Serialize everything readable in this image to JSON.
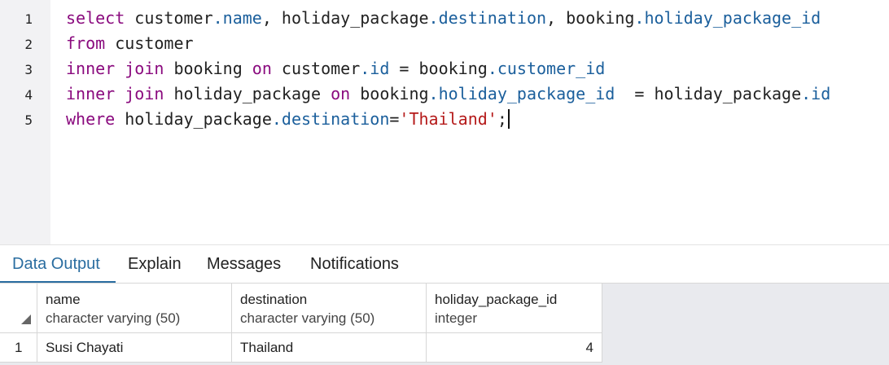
{
  "editor": {
    "line_numbers": [
      "1",
      "2",
      "3",
      "4",
      "5"
    ],
    "lines": [
      [
        {
          "t": "select",
          "k": "kw"
        },
        {
          "t": " customer",
          "k": ""
        },
        {
          "t": ".name",
          "k": "prop"
        },
        {
          "t": ", holiday_package",
          "k": ""
        },
        {
          "t": ".destination",
          "k": "prop"
        },
        {
          "t": ", booking",
          "k": ""
        },
        {
          "t": ".holiday_package_id",
          "k": "prop"
        }
      ],
      [
        {
          "t": "from",
          "k": "kw"
        },
        {
          "t": " customer",
          "k": ""
        }
      ],
      [
        {
          "t": "inner join",
          "k": "kw"
        },
        {
          "t": " booking ",
          "k": ""
        },
        {
          "t": "on",
          "k": "kw"
        },
        {
          "t": " customer",
          "k": ""
        },
        {
          "t": ".id",
          "k": "prop"
        },
        {
          "t": " = booking",
          "k": ""
        },
        {
          "t": ".customer_id",
          "k": "prop"
        }
      ],
      [
        {
          "t": "inner join",
          "k": "kw"
        },
        {
          "t": " holiday_package ",
          "k": ""
        },
        {
          "t": "on",
          "k": "kw"
        },
        {
          "t": " booking",
          "k": ""
        },
        {
          "t": ".holiday_package_id",
          "k": "prop"
        },
        {
          "t": "  = holiday_package",
          "k": ""
        },
        {
          "t": ".id",
          "k": "prop"
        }
      ],
      [
        {
          "t": "where",
          "k": "kw"
        },
        {
          "t": " holiday_package",
          "k": ""
        },
        {
          "t": ".destination",
          "k": "prop"
        },
        {
          "t": "=",
          "k": ""
        },
        {
          "t": "'Thailand'",
          "k": "str"
        },
        {
          "t": ";",
          "k": ""
        }
      ]
    ]
  },
  "tabs": [
    {
      "label": "Data Output",
      "active": true
    },
    {
      "label": "Explain",
      "active": false
    },
    {
      "label": "Messages",
      "active": false
    },
    {
      "label": "Notifications",
      "active": false
    }
  ],
  "results": {
    "columns": [
      {
        "name": "name",
        "type": "character varying (50)"
      },
      {
        "name": "destination",
        "type": "character varying (50)"
      },
      {
        "name": "holiday_package_id",
        "type": "integer"
      }
    ],
    "rows": [
      {
        "num": "1",
        "cells": [
          "Susi Chayati",
          "Thailand",
          "4"
        ]
      }
    ]
  }
}
